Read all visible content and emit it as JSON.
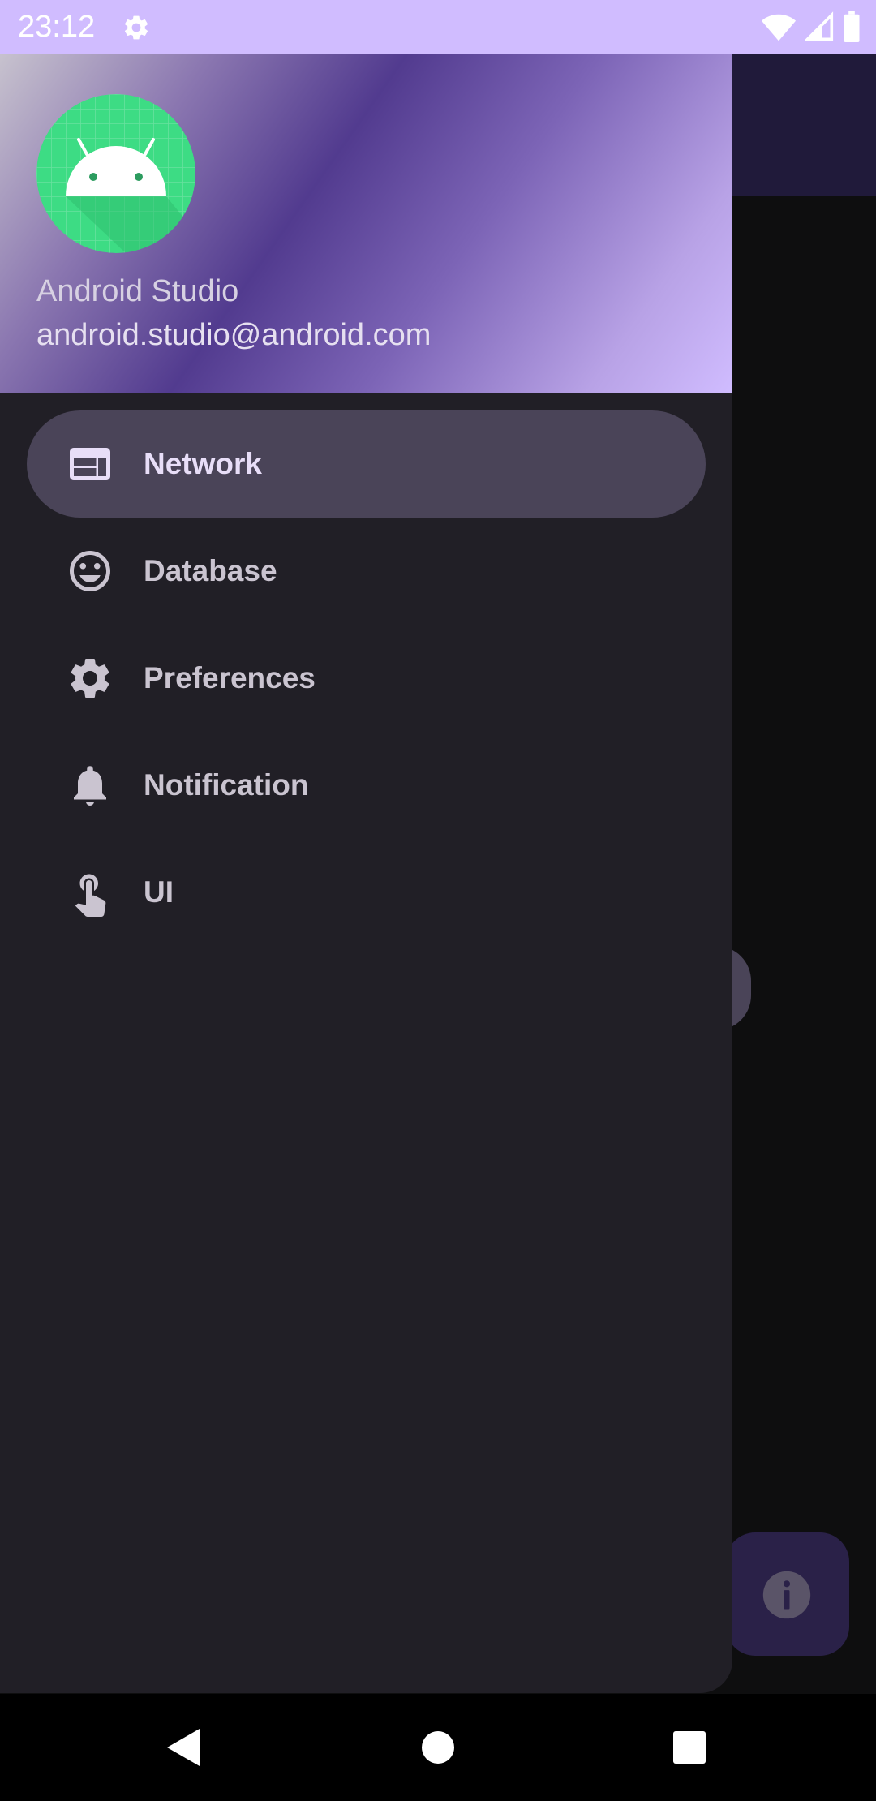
{
  "status_bar": {
    "time": "23:12",
    "icons": [
      "settings-icon",
      "wifi-icon",
      "cellular-signal-icon",
      "battery-icon"
    ]
  },
  "drawer": {
    "header": {
      "user_name": "Android Studio",
      "user_email": "android.studio@android.com",
      "avatar": "android-robot-avatar"
    },
    "menu": [
      {
        "label": "Network",
        "icon": "web-window-icon",
        "selected": true
      },
      {
        "label": "Database",
        "icon": "smiley-face-icon",
        "selected": false
      },
      {
        "label": "Preferences",
        "icon": "gear-icon",
        "selected": false
      },
      {
        "label": "Notification",
        "icon": "bell-icon",
        "selected": false
      },
      {
        "label": "UI",
        "icon": "touch-hand-icon",
        "selected": false
      }
    ]
  },
  "app": {
    "fab_icon": "info-icon"
  },
  "nav_bar": {
    "buttons": [
      "back-button",
      "home-button",
      "recents-button"
    ]
  },
  "colors": {
    "status_bar": "#d0bcff",
    "drawer_background": "#211f26",
    "selected_item": "#4a4458",
    "text_selected": "#e8def8",
    "text_normal": "#cac4d0"
  }
}
